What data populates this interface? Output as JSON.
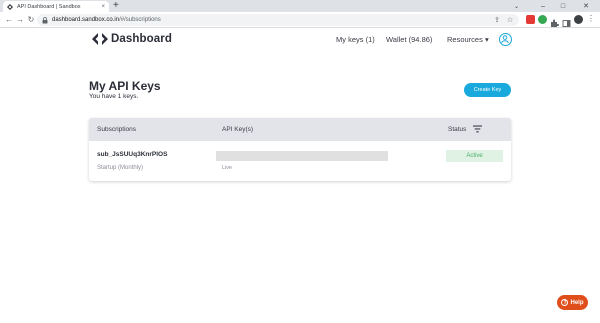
{
  "browser": {
    "tab_title": "API Dashboard | Sandbox",
    "tab_close": "×",
    "new_tab": "+",
    "url_host": "dashboard.sandbox.co.in",
    "url_path": "/#/subscriptions",
    "back": "←",
    "forward": "→",
    "reload": "↻",
    "tab_search": "⌄",
    "minimize": "–",
    "maximize": "□",
    "close": "✕",
    "share_icon": "⇪",
    "star_icon": "☆",
    "menu_icon": "⋮",
    "colors": {
      "ext1": "#e53935",
      "ext2": "#34a853",
      "ext3": "#5f6368",
      "ext4": "#5f6368"
    }
  },
  "header": {
    "brand": "Dashboard",
    "nav": {
      "my_keys": "My keys (1)",
      "wallet": "Wallet (94.86)",
      "resources": "Resources",
      "resources_caret": "▾"
    },
    "accent": "#1ea7d9"
  },
  "main": {
    "title": "My API Keys",
    "subtitle": "You have 1 keys.",
    "create_button": "Create Key",
    "table": {
      "headers": {
        "subscriptions": "Subscriptions",
        "api_keys": "API Key(s)",
        "status": "Status"
      },
      "rows": [
        {
          "subscription_id": "sub_JsSUUq3KnrPlOS",
          "plan": "Startup  (Monthly)",
          "key_env": "Live",
          "status": "Active"
        }
      ]
    }
  },
  "help": {
    "label": "Help",
    "icon": "?"
  }
}
